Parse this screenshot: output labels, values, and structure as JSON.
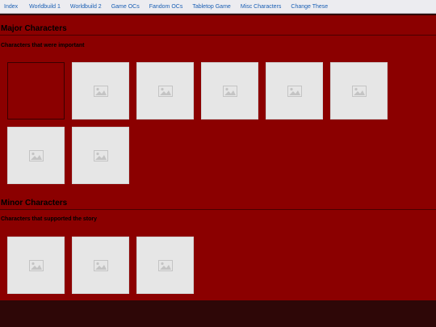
{
  "nav": {
    "items": [
      {
        "label": "Index"
      },
      {
        "label": "Worldbuild 1"
      },
      {
        "label": "Worldbuild 2"
      },
      {
        "label": "Game OCs"
      },
      {
        "label": "Fandom OCs"
      },
      {
        "label": "Tabletop Game"
      },
      {
        "label": "Misc Characters"
      },
      {
        "label": "Change These"
      }
    ]
  },
  "major": {
    "title": "Major Characters",
    "subtitle": "Characters that were important",
    "cards": [
      {
        "state": "empty"
      },
      {
        "state": "placeholder",
        "icon": "image-placeholder-icon"
      },
      {
        "state": "placeholder",
        "icon": "image-placeholder-icon"
      },
      {
        "state": "placeholder",
        "icon": "image-placeholder-icon"
      },
      {
        "state": "placeholder",
        "icon": "image-placeholder-icon"
      },
      {
        "state": "placeholder",
        "icon": "image-placeholder-icon"
      },
      {
        "state": "placeholder",
        "icon": "image-placeholder-icon"
      },
      {
        "state": "placeholder",
        "icon": "image-placeholder-icon"
      }
    ]
  },
  "minor": {
    "title": "Minor Characters",
    "subtitle": "Characters that supported the story",
    "cards": [
      {
        "state": "placeholder",
        "icon": "image-placeholder-icon"
      },
      {
        "state": "placeholder",
        "icon": "image-placeholder-icon"
      },
      {
        "state": "placeholder",
        "icon": "image-placeholder-icon"
      }
    ]
  },
  "colors": {
    "nav_bg": "#ececf0",
    "nav_link": "#1a5fb4",
    "content_bg": "#8b0000",
    "page_bg": "#2e0707",
    "card_bg": "#e6e6e6"
  }
}
